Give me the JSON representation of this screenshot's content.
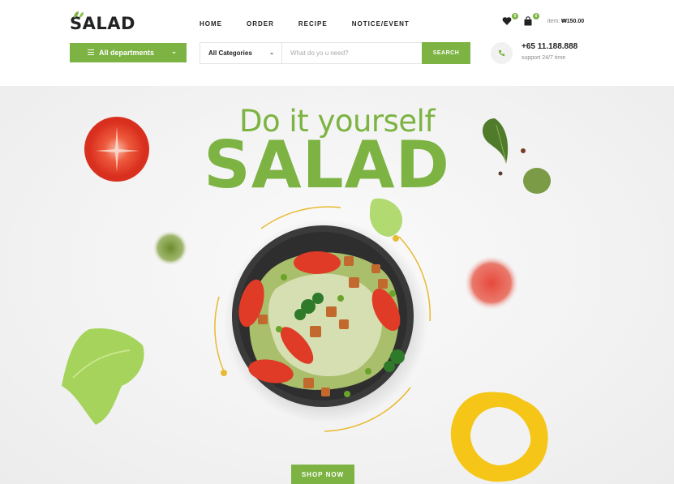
{
  "brand": {
    "logo_text": "SALAD",
    "accent": "#7cb342"
  },
  "nav": {
    "items": [
      {
        "label": "HOME"
      },
      {
        "label": "ORDER"
      },
      {
        "label": "RECIPE"
      },
      {
        "label": "NOTICE/EVENT"
      }
    ]
  },
  "header_actions": {
    "wishlist_icon": "heart-icon",
    "wishlist_count": "0",
    "cart_icon": "shopping-bag-icon",
    "cart_count": "0",
    "cart_label": "item:",
    "cart_total": "₩150.00"
  },
  "departments": {
    "label": "All departments",
    "icon": "menu-icon"
  },
  "search": {
    "category": "All Categories",
    "placeholder": "What do yo u need?",
    "value": "",
    "button_label": "SEARCH"
  },
  "contact": {
    "icon": "phone-icon",
    "phone": "+65 11.188.888",
    "support": "support 24/7 time"
  },
  "hero": {
    "subtitle": "Do it yourself",
    "title": "SALAD",
    "cta_label": "SHOP NOW"
  }
}
